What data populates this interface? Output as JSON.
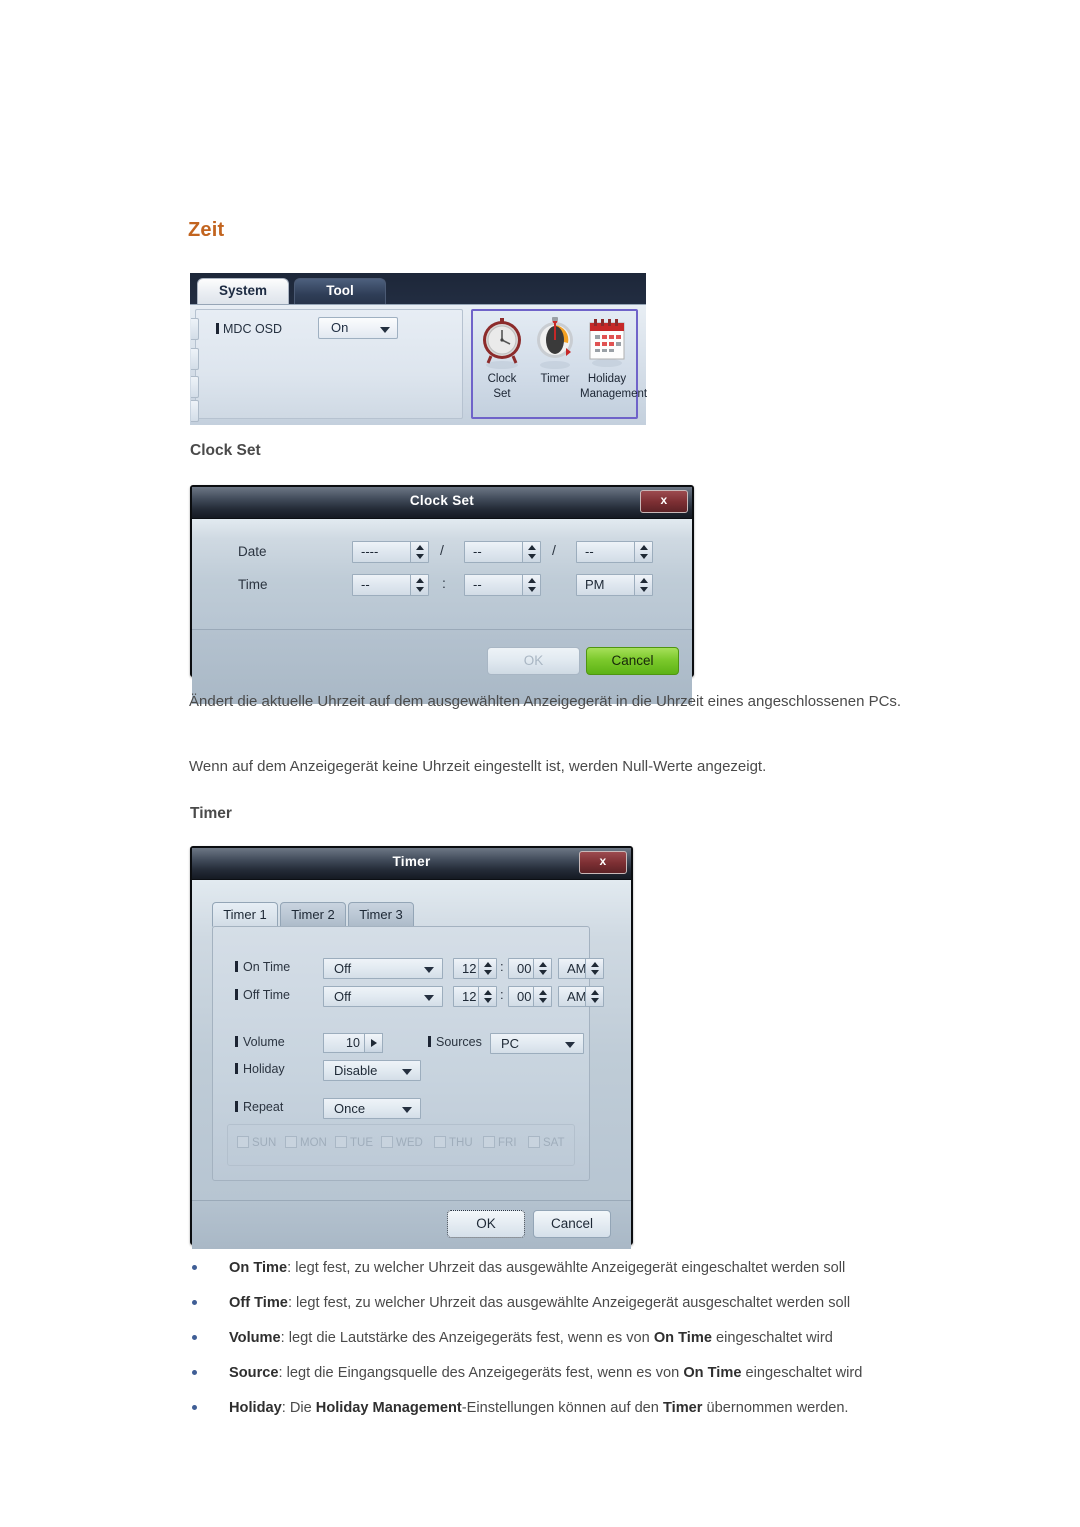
{
  "page": {
    "heading": "Zeit",
    "section_clock_set": "Clock Set",
    "section_timer": "Timer",
    "paragraph_1": "Ändert die aktuelle Uhrzeit auf dem ausgewählten Anzeigegerät in die Uhrzeit eines angeschlossenen PCs.",
    "paragraph_2": "Wenn auf dem Anzeigegerät keine Uhrzeit eingestellt ist, werden Null-Werte angezeigt.",
    "heading_color": "#c2641f"
  },
  "mdc_panel": {
    "tabs": [
      {
        "label": "System",
        "active": true
      },
      {
        "label": "Tool",
        "active": false
      }
    ],
    "osd": {
      "label": "MDC OSD",
      "value": "On"
    },
    "icons": [
      {
        "label_line1": "Clock",
        "label_line2": "Set",
        "icon": "alarm-clock-icon"
      },
      {
        "label_line1": "Timer",
        "label_line2": "",
        "icon": "stopwatch-icon"
      },
      {
        "label_line1": "Holiday",
        "label_line2": "Management",
        "icon": "calendar-icon"
      }
    ],
    "selection_color": "#6f63c9"
  },
  "clock_set_dialog": {
    "title": "Clock Set",
    "close_label": "x",
    "rows": [
      {
        "label": "Date",
        "fields": [
          {
            "value": "----",
            "type": "spinner"
          },
          {
            "value": "--",
            "type": "spinner"
          },
          {
            "value": "--",
            "type": "spinner"
          }
        ],
        "separators": [
          "/",
          "/"
        ]
      },
      {
        "label": "Time",
        "fields": [
          {
            "value": "--",
            "type": "spinner"
          },
          {
            "value": "--",
            "type": "spinner"
          },
          {
            "value": "PM",
            "type": "spinner"
          }
        ],
        "separators": [
          ":",
          ""
        ]
      }
    ],
    "buttons": {
      "ok": "OK",
      "cancel": "Cancel"
    }
  },
  "timer_dialog": {
    "title": "Timer",
    "close_label": "x",
    "tabs": [
      {
        "label": "Timer 1",
        "active": true
      },
      {
        "label": "Timer 2",
        "active": false
      },
      {
        "label": "Timer 3",
        "active": false
      }
    ],
    "on_time": {
      "label": "On Time",
      "mode": "Off",
      "hour": "12",
      "minute": "00",
      "meridiem": "AM",
      "separator": ":"
    },
    "off_time": {
      "label": "Off Time",
      "mode": "Off",
      "hour": "12",
      "minute": "00",
      "meridiem": "AM",
      "separator": ":"
    },
    "volume": {
      "label": "Volume",
      "value": "10"
    },
    "sources": {
      "label": "Sources",
      "value": "PC"
    },
    "holiday": {
      "label": "Holiday",
      "value": "Disable"
    },
    "repeat": {
      "label": "Repeat",
      "value": "Once"
    },
    "days": [
      {
        "label": "SUN",
        "checked": false
      },
      {
        "label": "MON",
        "checked": false
      },
      {
        "label": "TUE",
        "checked": false
      },
      {
        "label": "WED",
        "checked": false
      },
      {
        "label": "THU",
        "checked": false
      },
      {
        "label": "FRI",
        "checked": false
      },
      {
        "label": "SAT",
        "checked": false
      }
    ],
    "buttons": {
      "ok": "OK",
      "cancel": "Cancel"
    }
  },
  "bullets": [
    {
      "term": "On Time",
      "text_1": ": legt fest, zu welcher Uhrzeit das ausgewählte Anzeigegerät eingeschaltet werden soll",
      "term_2": "",
      "text_2": "",
      "term_3": "",
      "text_3": ""
    },
    {
      "term": "Off Time",
      "text_1": ": legt fest, zu welcher Uhrzeit das ausgewählte Anzeigegerät ausgeschaltet werden soll",
      "term_2": "",
      "text_2": "",
      "term_3": "",
      "text_3": ""
    },
    {
      "term": "Volume",
      "text_1": ": legt die Lautstärke des Anzeigegeräts fest, wenn es von ",
      "term_2": "On Time",
      "text_2": " eingeschaltet wird",
      "term_3": "",
      "text_3": ""
    },
    {
      "term": "Source",
      "text_1": ": legt die Eingangsquelle des Anzeigegeräts fest, wenn es von ",
      "term_2": "On Time",
      "text_2": " eingeschaltet wird",
      "term_3": "",
      "text_3": ""
    },
    {
      "term": "Holiday",
      "text_1": ": Die ",
      "term_2": "Holiday Management",
      "text_2": "-Einstellungen können auf den ",
      "term_3": "Timer",
      "text_3": " übernommen werden."
    }
  ]
}
